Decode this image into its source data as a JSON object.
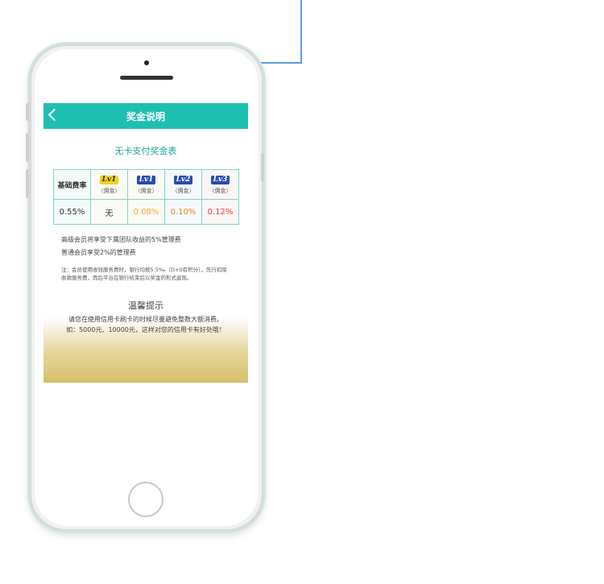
{
  "navbar": {
    "title": "奖金说明"
  },
  "table": {
    "title": "无卡支付奖金表",
    "row_header": "基础费率",
    "levels": [
      {
        "badge": "Lv1",
        "sub": "（佣金）",
        "color": "#f3d21d"
      },
      {
        "badge": "Lv1",
        "sub": "（佣金）",
        "color": "#2b4bb7"
      },
      {
        "badge": "Lv2",
        "sub": "（佣金）",
        "color": "#2b4bb7"
      },
      {
        "badge": "Lv3",
        "sub": "（佣金）",
        "color": "#2b4bb7"
      }
    ],
    "values": [
      "0.55%",
      "无",
      "0.08%",
      "0.10%",
      "0.12%"
    ]
  },
  "notes": {
    "line1": "高级会员将享受下属团队收益的5%管理费",
    "line2": "普通会员享受2%的管理费",
    "footnote": "注：会员使用收钱服务费时，银行均按5.5‰（D+0有积分），先行扣除收款服务费，而后平台在银行结束后以奖金的形式返现。"
  },
  "tips": {
    "title": "温馨提示",
    "line1": "请您在使用信用卡刷卡的时候尽量避免整数大额消费。",
    "line2": "如：5000元、10000元，这样对您的信用卡有好处哦！"
  }
}
